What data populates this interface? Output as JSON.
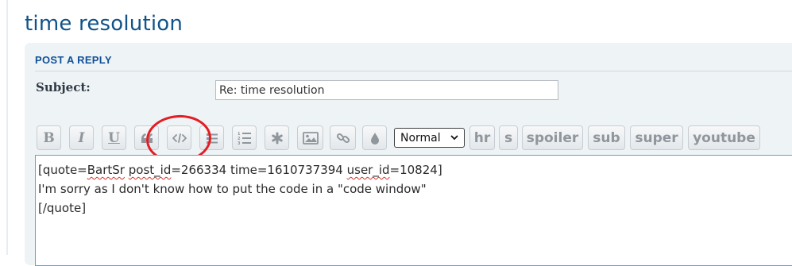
{
  "page": {
    "title": "time resolution"
  },
  "panel": {
    "header": "POST A REPLY"
  },
  "subject": {
    "label": "Subject:",
    "value": "Re: time resolution"
  },
  "toolbar": {
    "buttons": [
      {
        "label": "B",
        "icon": "bold-icon"
      },
      {
        "label": "I",
        "icon": "italic-icon"
      },
      {
        "label": "U",
        "icon": "underline-icon"
      },
      {
        "label": "",
        "icon": "quote-icon"
      },
      {
        "label": "",
        "icon": "code-icon"
      },
      {
        "label": "",
        "icon": "bullet-list-icon"
      },
      {
        "label": "",
        "icon": "numbered-list-icon"
      },
      {
        "label": "",
        "icon": "asterisk-icon"
      },
      {
        "label": "",
        "icon": "image-icon"
      },
      {
        "label": "",
        "icon": "link-icon"
      },
      {
        "label": "",
        "icon": "color-drop-icon"
      }
    ],
    "font_size": {
      "selected": "Normal"
    },
    "custom": {
      "hr": "hr",
      "s": "s",
      "spoiler": "spoiler",
      "sub": "sub",
      "super": "super",
      "youtube": "youtube"
    }
  },
  "editor": {
    "lines": {
      "l1_a": "[quote=",
      "l1_b": "BartSr",
      "l1_c": " ",
      "l1_d": "post_id",
      "l1_e": "=266334 time=1610737394 ",
      "l1_f": "user_id",
      "l1_g": "=10824]",
      "l2": "I'm sorry as I don't know how to put the code in a \"code window\"",
      "l3": "[/quote]"
    }
  },
  "annotation": {
    "color": "#e21d24",
    "target": "code-icon"
  },
  "colors": {
    "title": "#105289",
    "panel": "#eef3f6",
    "accent": "#115098",
    "editor_border": "#66a3c7"
  }
}
